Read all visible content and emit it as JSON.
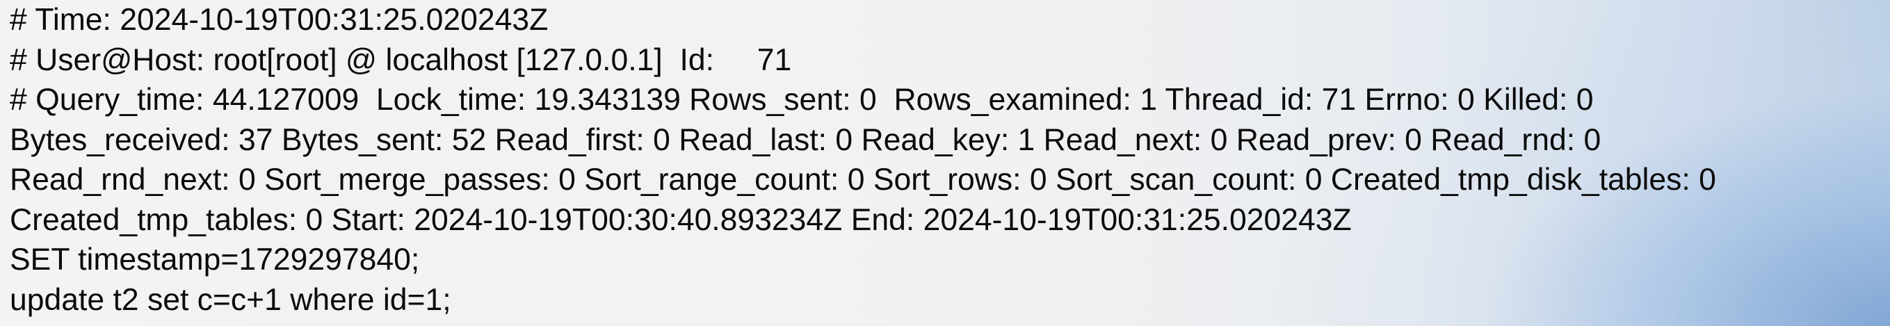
{
  "log": {
    "lines": [
      "# Time: 2024-10-19T00:31:25.020243Z",
      "# User@Host: root[root] @ localhost [127.0.0.1]  Id:     71",
      "# Query_time: 44.127009  Lock_time: 19.343139 Rows_sent: 0  Rows_examined: 1 Thread_id: 71 Errno: 0 Killed: 0",
      "Bytes_received: 37 Bytes_sent: 52 Read_first: 0 Read_last: 0 Read_key: 1 Read_next: 0 Read_prev: 0 Read_rnd: 0",
      "Read_rnd_next: 0 Sort_merge_passes: 0 Sort_range_count: 0 Sort_rows: 0 Sort_scan_count: 0 Created_tmp_disk_tables: 0",
      "Created_tmp_tables: 0 Start: 2024-10-19T00:30:40.893234Z End: 2024-10-19T00:31:25.020243Z",
      "SET timestamp=1729297840;",
      "update t2 set c=c+1 where id=1;"
    ]
  }
}
